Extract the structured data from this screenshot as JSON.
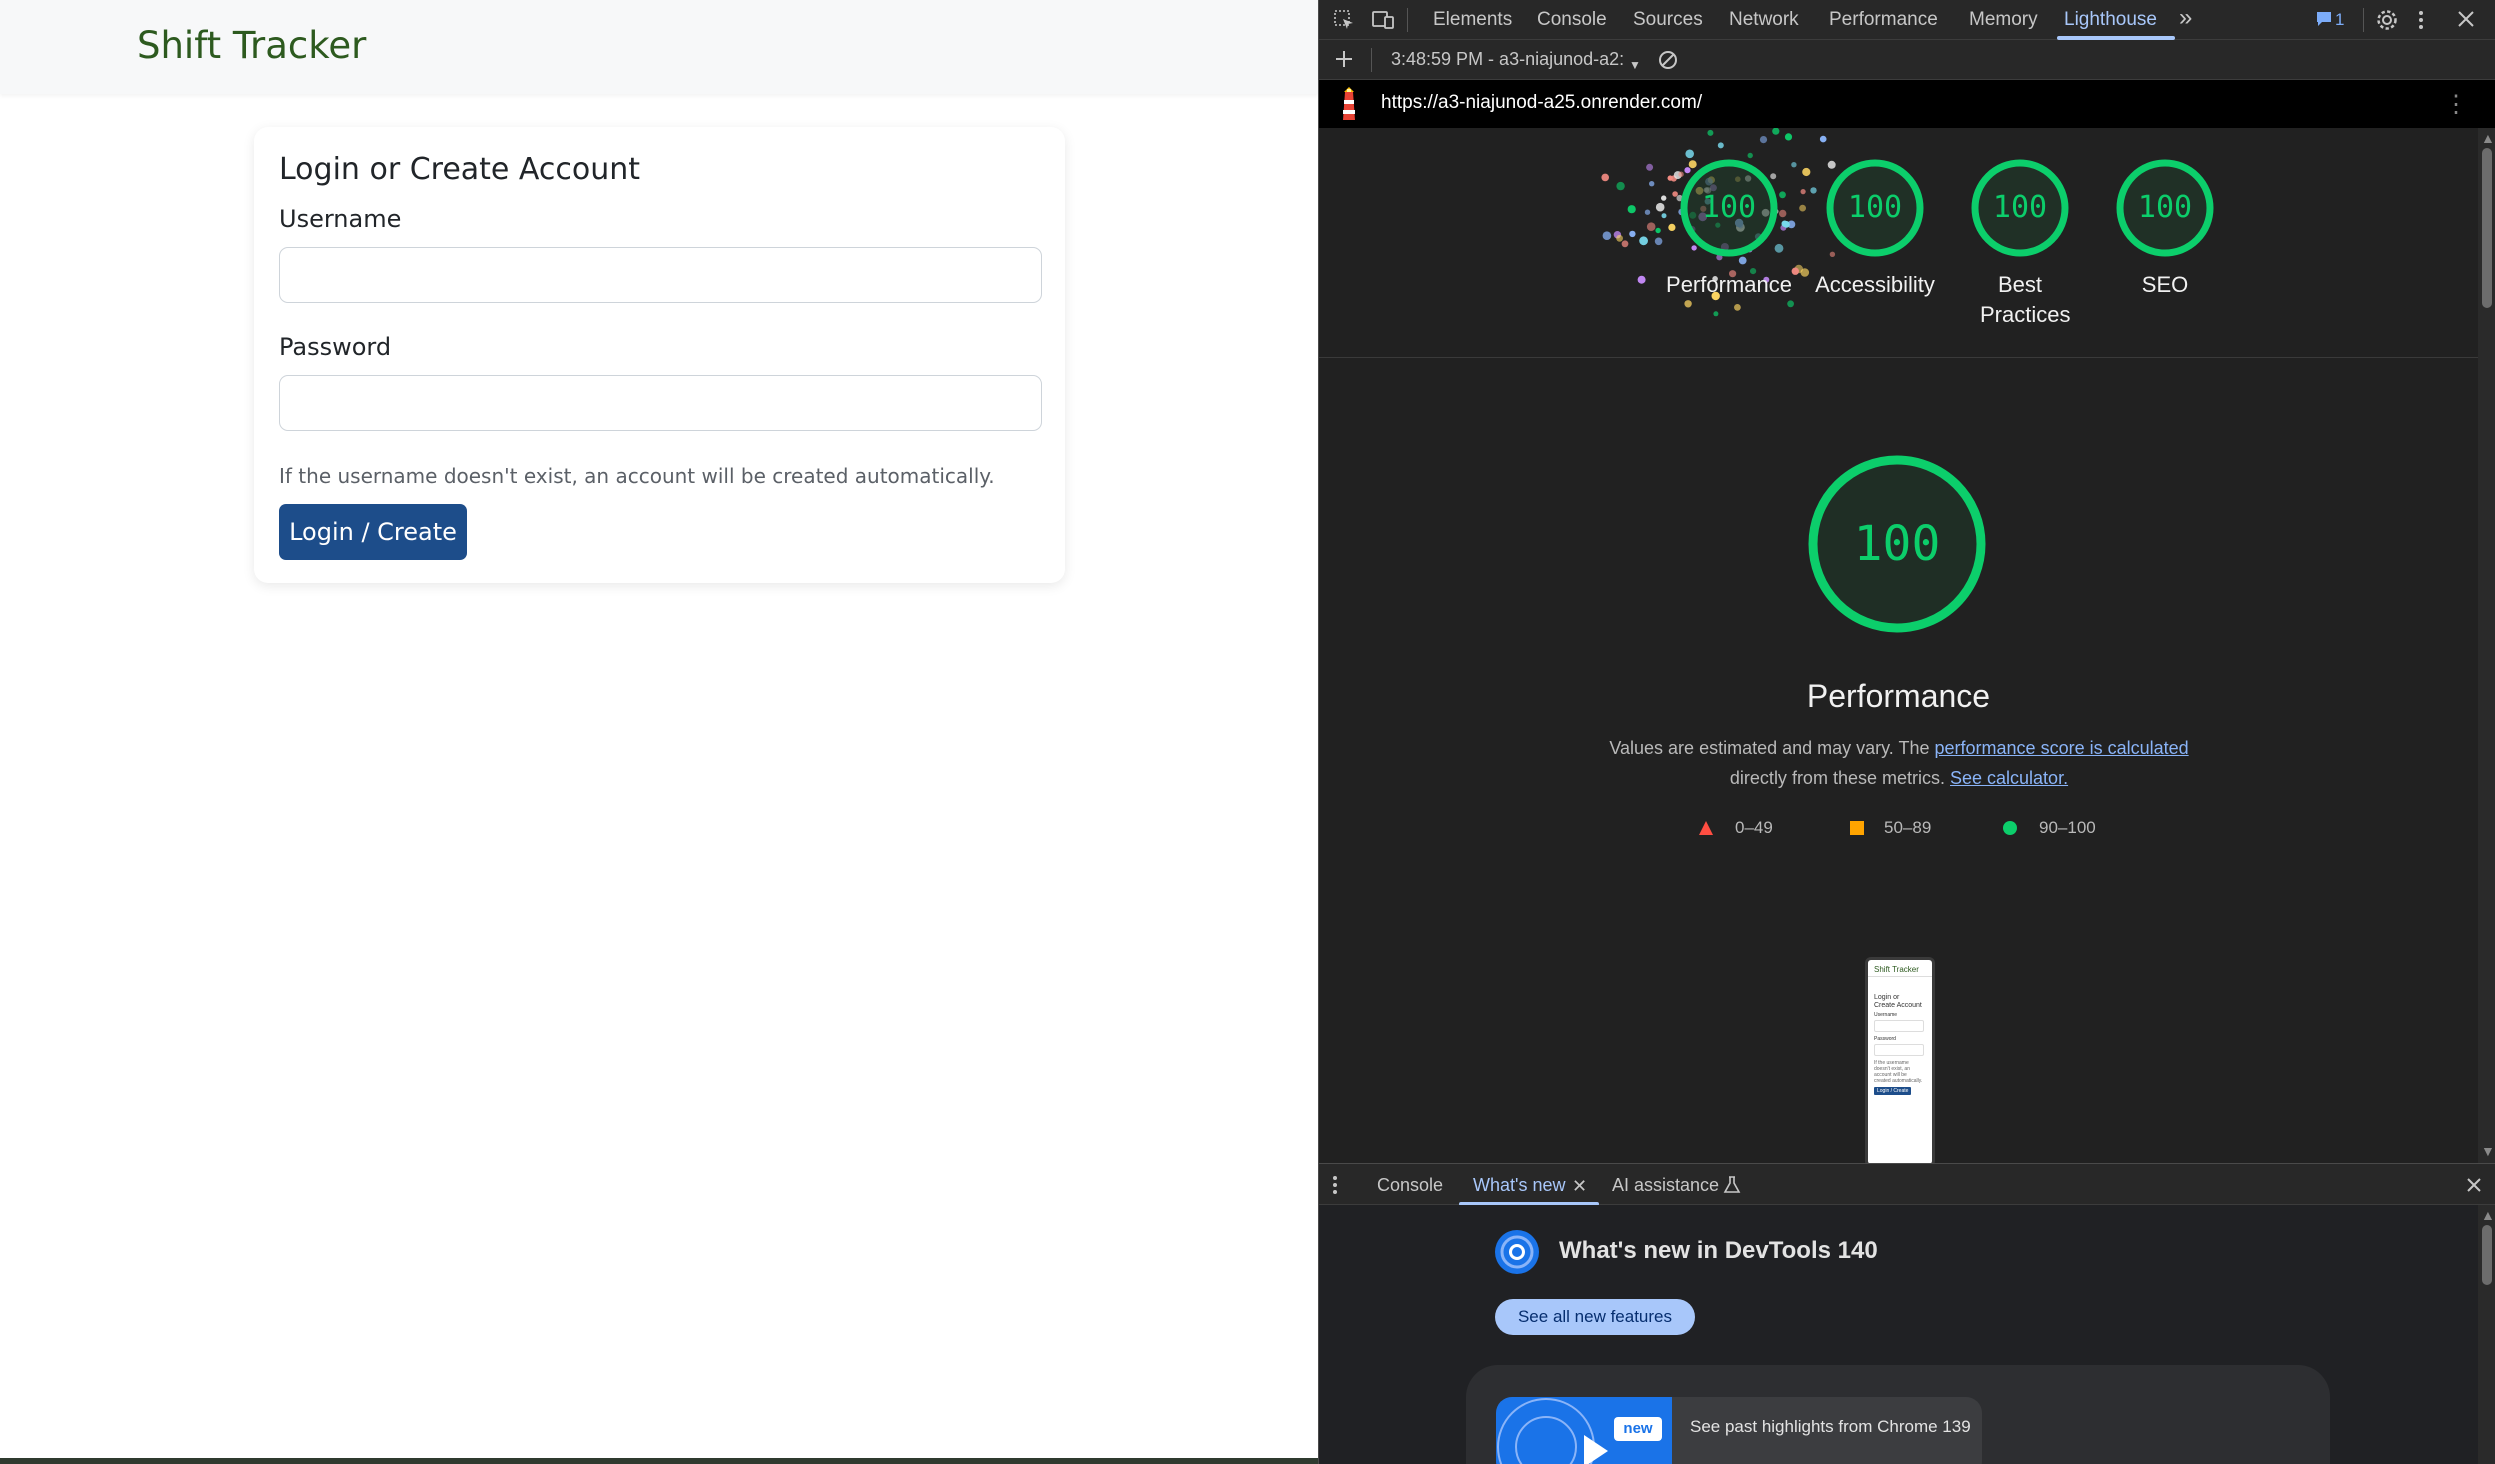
{
  "site": {
    "brand": "Shift Tracker",
    "card_title": "Login or Create Account",
    "username_label": "Username",
    "username_value": "",
    "password_label": "Password",
    "password_value": "",
    "help_text": "If the username doesn't exist, an account will be created automatically.",
    "submit_label": "Login / Create"
  },
  "devtools": {
    "tabs": [
      "Elements",
      "Console",
      "Sources",
      "Network",
      "Performance",
      "Memory",
      "Lighthouse"
    ],
    "active_tab": "Lighthouse",
    "issues_count": "1",
    "report_selector": "3:48:59 PM - a3-niajunod-a2:",
    "report_url": "https://a3-niajunod-a25.onrender.com/",
    "scores": [
      {
        "label": "Performance",
        "value": "100"
      },
      {
        "label": "Accessibility",
        "value": "100"
      },
      {
        "label": "Best Practices",
        "value": "100"
      },
      {
        "label": "SEO",
        "value": "100"
      }
    ],
    "perf": {
      "score": "100",
      "title": "Performance",
      "desc_prefix": "Values are estimated and may vary. The ",
      "desc_link1": "performance score is calculated",
      "desc_middle": "directly from these metrics.",
      "desc_link2": "See calculator.",
      "legend": {
        "fail": "0–49",
        "average": "50–89",
        "pass": "90–100"
      }
    },
    "thumbnail": {
      "brand": "Shift Tracker",
      "title_line1": "Login or",
      "title_line2": "Create Account",
      "username": "Username",
      "password": "Password",
      "help_line1": "If the username",
      "help_line2": "doesn't exist, an",
      "help_line3": "account will be",
      "help_line4": "created automatically.",
      "button": "Login / Create"
    },
    "drawer": {
      "tabs": [
        "Console",
        "What's new",
        "AI assistance"
      ],
      "active_tab": "What's new",
      "title": "What's new in DevTools 140",
      "see_all": "See all new features",
      "badge": "new",
      "highlight": "See past highlights from Chrome 139"
    },
    "colors": {
      "pass": "#0cce6b",
      "average": "#ffa400",
      "fail": "#ff4e42",
      "accent": "#a8c7fa"
    }
  }
}
